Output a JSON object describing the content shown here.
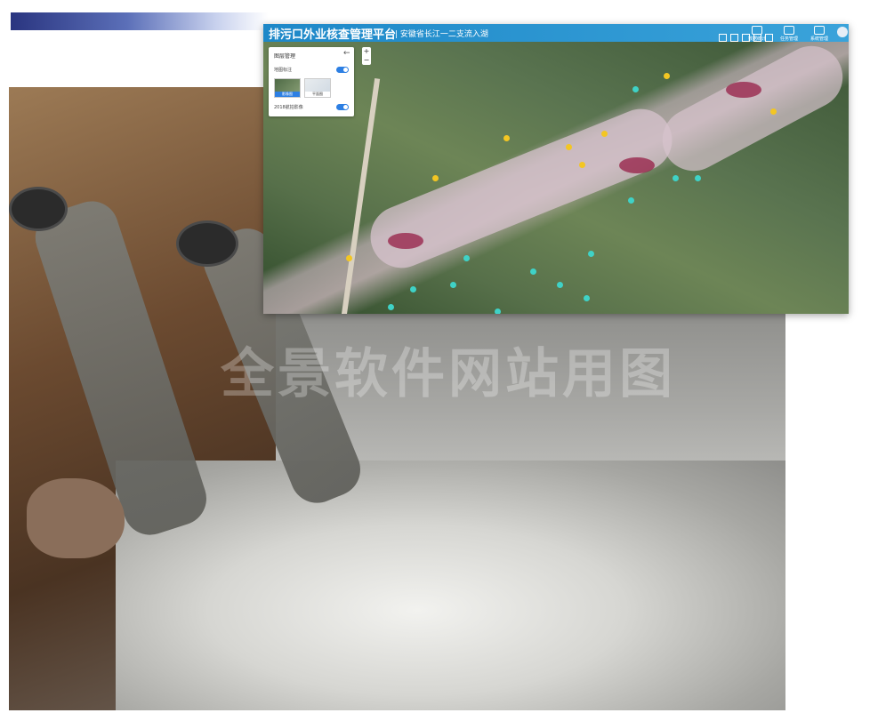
{
  "app": {
    "title": "排污口外业核查管理平台",
    "subtitle": "| 安徽省长江一二支流入湖"
  },
  "header_nav": [
    {
      "label": "数据统计"
    },
    {
      "label": "任务管理"
    },
    {
      "label": "系统管理"
    }
  ],
  "layer_panel": {
    "title": "图层管理",
    "close_icon": "arrow-left-icon",
    "map_annotation_label": "地图标注",
    "basemaps": [
      {
        "label": "影像图",
        "selected": true
      },
      {
        "label": "平面图",
        "selected": false
      }
    ],
    "layer_2018_label": "2018航拍影像"
  },
  "zoom": {
    "zoom_in": "+",
    "zoom_out": "−"
  },
  "watermark": "全景软件网站用图",
  "colors": {
    "header": "#1e88c8",
    "toggle_on": "#2d7fe3",
    "marker_yellow": "#f3c623",
    "marker_cyan": "#3fd2c7"
  }
}
